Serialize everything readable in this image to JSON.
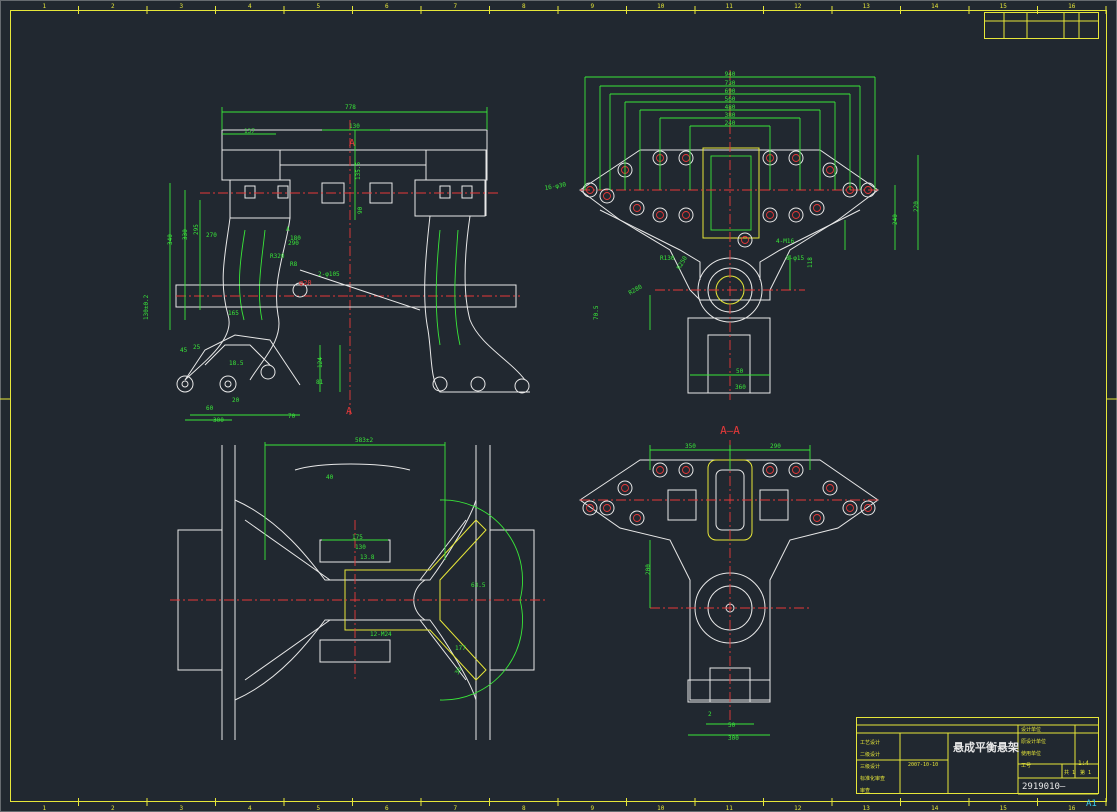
{
  "drawing": {
    "title": "悬成平衡悬架",
    "drawing_number": "2919010—",
    "sheet_size": "A1",
    "scale": "1:4",
    "section_label": "A—A",
    "section_mark": "A",
    "colors": {
      "background": "#212830",
      "frame": "#e6e639",
      "outline": "#e8e8e8",
      "dimension": "#39e639",
      "centerline": "#e63939",
      "hidden": "#38c8e8"
    }
  },
  "border": {
    "column_numbers": [
      "1",
      "2",
      "3",
      "4",
      "5",
      "6",
      "7",
      "8",
      "9",
      "10",
      "11",
      "12",
      "13",
      "14",
      "15",
      "16"
    ]
  },
  "title_block": {
    "date": "2007-10-10",
    "left_labels": [
      "工艺设计",
      "二级设计",
      "三级设计",
      "标准化审查",
      "审查"
    ],
    "right_labels": [
      "设计单位",
      "原设计单位",
      "使用单位",
      "工号"
    ],
    "sheet_info": [
      "共 1",
      "第 1"
    ]
  },
  "dimensions": {
    "top_left": [
      "778",
      "137",
      "130",
      "135.5",
      "90",
      "340",
      "330",
      "295",
      "270",
      "290",
      "180",
      "165",
      "124",
      "81",
      "60",
      "45",
      "25",
      "20",
      "18.5",
      "70",
      "300",
      "130±0.2",
      "2-φ105",
      "R320",
      "R8",
      "φ20",
      "A"
    ],
    "top_right": [
      "940",
      "730",
      "690",
      "560",
      "480",
      "380",
      "240",
      "16-φ30",
      "220",
      "240",
      "118",
      "70.5",
      "R130",
      "R250",
      "R280",
      "8-φ15",
      "50",
      "360",
      "4-M16"
    ],
    "bottom_left": [
      "583±2",
      "175",
      "130",
      "13.8",
      "40",
      "12-M24",
      "63.5",
      "177",
      "30"
    ],
    "bottom_right": [
      "350",
      "290",
      "200",
      "2",
      "50",
      "300"
    ]
  }
}
